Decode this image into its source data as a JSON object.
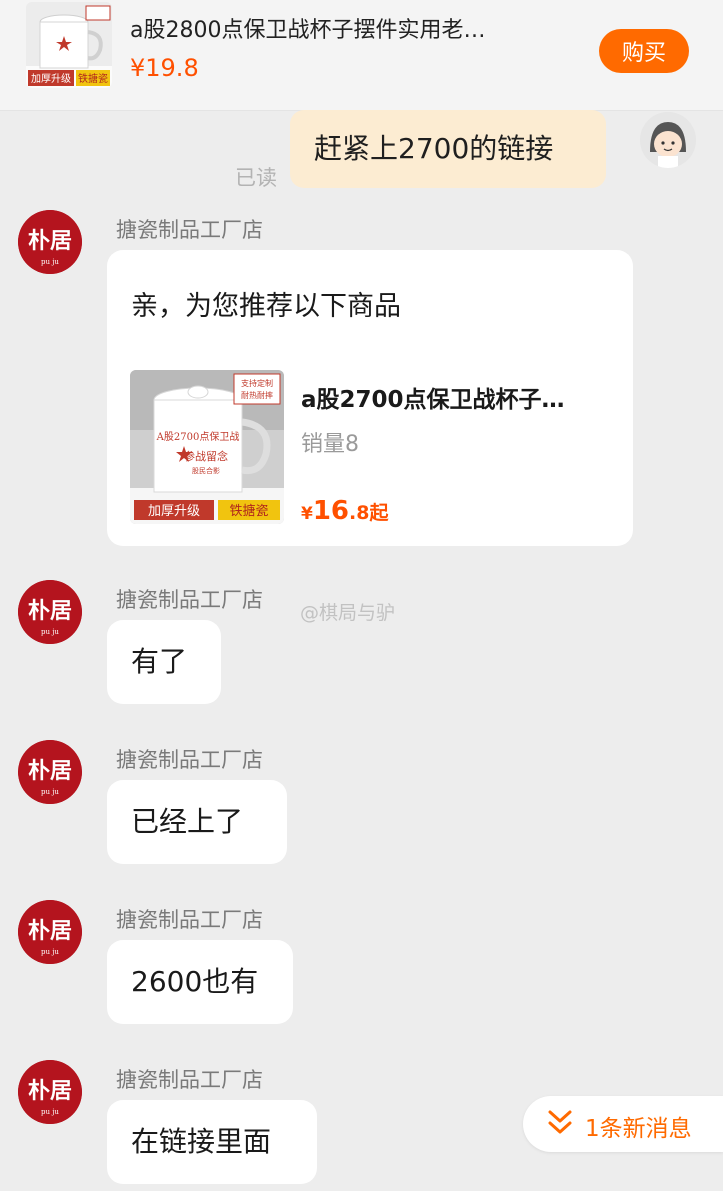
{
  "product": {
    "title": "a股2800点保卫战杯子摆件实用老…",
    "price": "¥19.8",
    "buy_label": "购买",
    "thumb_badges": [
      "加厚升级",
      "铁搪瓷"
    ]
  },
  "my_message": {
    "text": "赶紧上2700的链接",
    "read_status": "已读"
  },
  "shop": {
    "name": "搪瓷制品工厂店",
    "avatar_text": "朴居",
    "avatar_small": "pu ju"
  },
  "recommendation": {
    "greeting": "亲，为您推荐以下商品",
    "item_title": "a股2700点保卫战杯子…",
    "sales": "销量8",
    "price_symbol": "¥",
    "price_int": "16",
    "price_dec": ".8",
    "price_suffix": "起",
    "thumb_badges": [
      "加厚升级",
      "铁搪瓷"
    ],
    "thumb_corner": [
      "支持定制",
      "耐热耐摔"
    ],
    "mug_text": [
      "A股2700点保卫战",
      "参战留念",
      "股民合影"
    ]
  },
  "messages": [
    {
      "text": "有了"
    },
    {
      "text": "已经上了"
    },
    {
      "text": "2600也有"
    },
    {
      "text": "在链接里面"
    }
  ],
  "watermark": "@棋局与驴",
  "new_message": "1条新消息",
  "colors": {
    "accent_orange": "#ff6a00",
    "price_orange": "#ff5000",
    "shop_avatar_red": "#b4141e",
    "my_bubble": "#fcecd2",
    "background": "#ededed"
  }
}
